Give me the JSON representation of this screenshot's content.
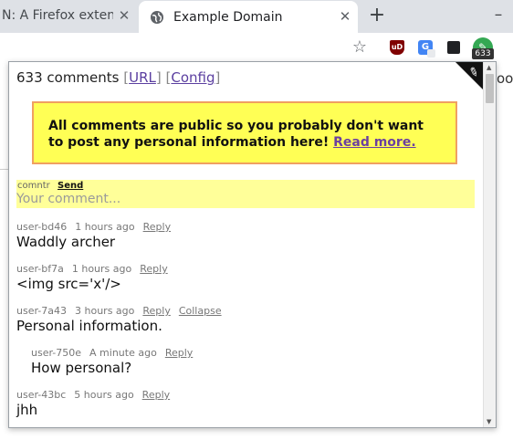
{
  "browser": {
    "tabs": [
      {
        "title": "N: A Firefox exten"
      },
      {
        "title": "Example Domain"
      }
    ],
    "extension_badge": "633",
    "page_fragment": "oo"
  },
  "popup": {
    "header": {
      "count_text": "633 comments",
      "bracket_open": "[",
      "bracket_close": "]",
      "url_link": "URL",
      "config_link": "Config"
    },
    "notice": {
      "text": "All comments are public so you probably don't want to post any personal information here!",
      "link": "Read more."
    },
    "composer": {
      "username": "comntr",
      "send_label": "Send",
      "placeholder": "Your comment..."
    },
    "comments": [
      {
        "user": "user-bd46",
        "time": "1 hours ago",
        "reply": "Reply",
        "text": "Waddly archer"
      },
      {
        "user": "user-bf7a",
        "time": "1 hours ago",
        "reply": "Reply",
        "text": "<img src='x'/>"
      },
      {
        "user": "user-7a43",
        "time": "3 hours ago",
        "reply": "Reply",
        "collapse": "Collapse",
        "text": "Personal information."
      },
      {
        "user": "user-750e",
        "time": "A minute ago",
        "reply": "Reply",
        "text": "How personal?"
      },
      {
        "user": "user-43bc",
        "time": "5 hours ago",
        "reply": "Reply",
        "text": "jhh"
      }
    ]
  },
  "colors": {
    "notice_bg": "#ffff55",
    "notice_border": "#f0a060",
    "composer_bg": "#ffff99",
    "link": "#5b3fa0"
  }
}
